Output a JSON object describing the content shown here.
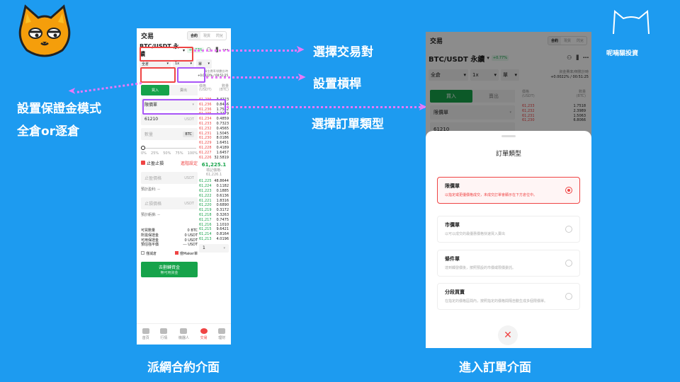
{
  "left_phone": {
    "title": "交易",
    "tabs": [
      "合約",
      "現貨",
      "閃兌"
    ],
    "pair": "BTC/USDT 永續",
    "change": "+0.77%",
    "margin_mode": "全倉",
    "leverage": "1x",
    "unit_select": "單",
    "funding_label": "資金費率/倒數計時",
    "funding_value": "+0.0022% / 00:51:25",
    "buy_label": "買入",
    "sell_label": "賣出",
    "order_type": "限價單",
    "price_value": "61210",
    "price_unit": "USDT",
    "qty_placeholder": "數量",
    "qty_unit": "BTC",
    "slider_marks": [
      "0%",
      "25%",
      "50%",
      "75%",
      "100%"
    ],
    "tpsl_label": "止盈止損",
    "advanced_label": "進階設定",
    "tp_placeholder": "止盈價格",
    "tp_est": "預計盈利: --",
    "sl_placeholder": "止損價格",
    "sl_est": "預計虧損: --",
    "stats": [
      {
        "k": "可買數量",
        "v": "0 BTC"
      },
      {
        "k": "所需保證金",
        "v": "0 USDT"
      },
      {
        "k": "可用保證金",
        "v": "0 USDT"
      },
      {
        "k": "預估強平價",
        "v": "--- USDT"
      }
    ],
    "reduce_only": "僅減倉",
    "maker_only": "僅Maker單",
    "submit_label": "去劃轉資金",
    "submit_sub": "無可用資金",
    "book_header_price": "價格\n(USDT)",
    "book_header_qty": "數量\n(BTC)",
    "asks": [
      [
        "61,236",
        "3.4223"
      ],
      [
        "61,236",
        "0.8446"
      ],
      [
        "61,236",
        "1.7542"
      ],
      [
        "61,235",
        "1.2279"
      ],
      [
        "61,234",
        "0.4859"
      ],
      [
        "61,233",
        "0.7323"
      ],
      [
        "61,232",
        "0.4565"
      ],
      [
        "61,231",
        "1.5045"
      ],
      [
        "61,230",
        "8.0186"
      ],
      [
        "61,229",
        "1.6451"
      ],
      [
        "61,228",
        "0.4189"
      ],
      [
        "61,227",
        "1.6457"
      ],
      [
        "61,226",
        "32.5819"
      ]
    ],
    "mid_price": "61,225.1",
    "mark_price": "標記價格: 61,226.1",
    "bids": [
      [
        "61,225",
        "48.8644"
      ],
      [
        "61,224",
        "0.1182"
      ],
      [
        "61,223",
        "0.1885"
      ],
      [
        "61,222",
        "0.6136"
      ],
      [
        "61,221",
        "1.8316"
      ],
      [
        "61,220",
        "0.6890"
      ],
      [
        "61,219",
        "0.3172"
      ],
      [
        "61,218",
        "0.3263"
      ],
      [
        "61,217",
        "0.7475"
      ],
      [
        "61,216",
        "1.1010"
      ],
      [
        "61,215",
        "9.6421"
      ],
      [
        "61,214",
        "0.8164"
      ],
      [
        "61,213",
        "4.0196"
      ]
    ],
    "depth_select": "1",
    "nav": [
      "首頁",
      "行情",
      "機器人",
      "交易",
      "理財"
    ]
  },
  "right_phone": {
    "title": "交易",
    "tabs": [
      "合約",
      "現貨",
      "閃兌"
    ],
    "pair": "BTC/USDT 永續",
    "change": "+0.77%",
    "margin_mode": "全倉",
    "leverage": "1x",
    "unit_select": "單",
    "funding_label": "資金費率/倒數計時",
    "funding_value": "+0.0022% / 00:51:25",
    "buy_label": "買入",
    "sell_label": "賣出",
    "order_type": "限價單",
    "book_header_price": "價格\n(USDT)",
    "book_header_qty": "數量\n(BTC)",
    "asks": [
      [
        "61,233",
        "1.7518"
      ],
      [
        "61,232",
        "2.3989"
      ],
      [
        "61,231",
        "1.5063"
      ],
      [
        "61,230",
        "6.8066"
      ]
    ],
    "price_value": "61210",
    "sheet_title": "訂單類型",
    "options": [
      {
        "title": "限價單",
        "desc": "以指定或更優價格成交，未成交訂單會顯示在下方倉位中。",
        "selected": true
      },
      {
        "title": "市價單",
        "desc": "以可以成交的最優惠價格快速買入賣出",
        "selected": false
      },
      {
        "title": "條件單",
        "desc": "達到觸發價後，按照預設的市價或限價委託。",
        "selected": false
      },
      {
        "title": "分段買賣",
        "desc": "在指定的價格區間內，按照指定的價格間隔自動生成多個限價單。",
        "selected": false
      }
    ]
  },
  "annotations": {
    "select_pair": "選擇交易對",
    "set_leverage": "設置槓桿",
    "margin_mode": "設置保證金模式\n全倉or逐倉",
    "order_type": "選擇訂單類型",
    "caption_left": "派網合約介面",
    "caption_right": "進入訂單介面",
    "brand": "呢喃貓投資"
  },
  "colors": {
    "background": "#1d9bf0",
    "buy": "#16a34a",
    "sell": "#ef4444",
    "highlight_red": "#ef4444",
    "highlight_purple": "#a855f7",
    "dotline": "#e879f9",
    "cat_orange": "#f59e0b"
  }
}
